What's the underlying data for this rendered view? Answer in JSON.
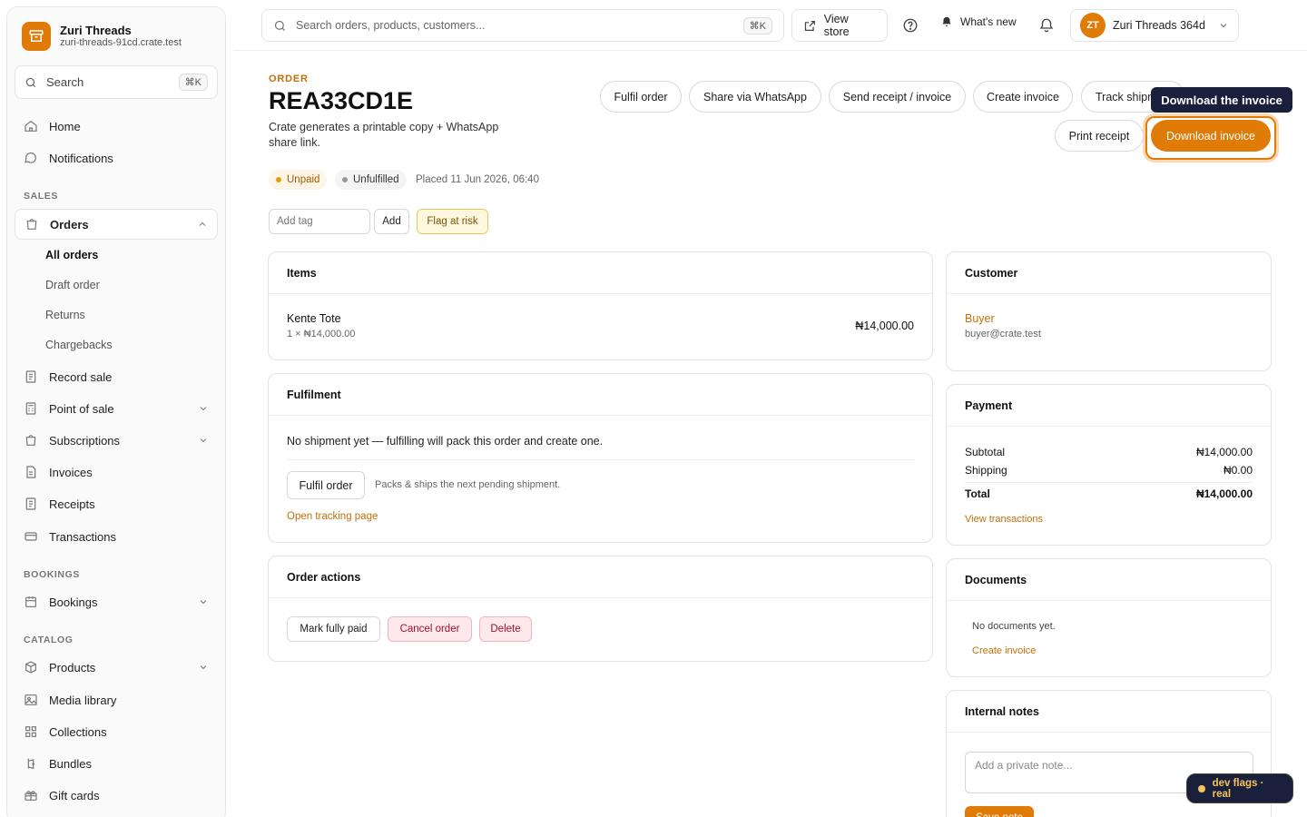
{
  "brand": {
    "name": "Zuri Threads",
    "url": "zuri-threads-91cd.crate.test"
  },
  "sidebar": {
    "search_label": "Search",
    "search_kbd": "⌘K",
    "home": "Home",
    "notifications": "Notifications",
    "sales_heading": "SALES",
    "orders": "Orders",
    "orders_sub": [
      "All orders",
      "Draft order",
      "Returns",
      "Chargebacks"
    ],
    "record_sale": "Record sale",
    "point_of_sale": "Point of sale",
    "subscriptions": "Subscriptions",
    "invoices": "Invoices",
    "receipts": "Receipts",
    "transactions": "Transactions",
    "bookings_heading": "BOOKINGS",
    "bookings": "Bookings",
    "catalog_heading": "CATALOG",
    "products": "Products",
    "media_library": "Media library",
    "collections": "Collections",
    "bundles": "Bundles",
    "gift_cards": "Gift cards"
  },
  "topbar": {
    "search_placeholder": "Search orders, products, customers...",
    "search_kbd": "⌘K",
    "view_store": "View store",
    "whats_new": "What's new",
    "account_initials": "ZT",
    "account_name": "Zuri Threads 364d"
  },
  "order": {
    "eyebrow": "ORDER",
    "id": "REA33CD1E",
    "description": "Crate generates a printable copy + WhatsApp share link.",
    "status_payment": "Unpaid",
    "status_fulfilment": "Unfulfilled",
    "placed": "Placed 11 Jun 2026, 06:40"
  },
  "actions": {
    "fulfil": "Fulfil order",
    "whatsapp": "Share via WhatsApp",
    "send_receipt": "Send receipt / invoice",
    "create_invoice": "Create invoice",
    "track": "Track shipment",
    "print_receipt": "Print receipt",
    "download_invoice": "Download invoice",
    "tooltip": "Download the invoice"
  },
  "tags": {
    "placeholder": "Add tag",
    "add": "Add",
    "flag": "Flag at risk"
  },
  "items_card": {
    "title": "Items",
    "item_name": "Kente Tote",
    "item_qty": "1 × ₦14,000.00",
    "item_total": "₦14,000.00"
  },
  "fulfilment_card": {
    "title": "Fulfilment",
    "message": "No shipment yet — fulfilling will pack this order and create one.",
    "button": "Fulfil order",
    "hint": "Packs & ships the next pending shipment.",
    "tracking_link": "Open tracking page"
  },
  "order_actions_card": {
    "title": "Order actions",
    "mark_paid": "Mark fully paid",
    "cancel": "Cancel order",
    "delete": "Delete"
  },
  "customer_card": {
    "title": "Customer",
    "name": "Buyer",
    "email": "buyer@crate.test"
  },
  "payment_card": {
    "title": "Payment",
    "subtotal_label": "Subtotal",
    "subtotal": "₦14,000.00",
    "shipping_label": "Shipping",
    "shipping": "₦0.00",
    "total_label": "Total",
    "total": "₦14,000.00",
    "transactions_link": "View transactions"
  },
  "documents_card": {
    "title": "Documents",
    "empty": "No documents yet.",
    "create_link": "Create invoice"
  },
  "notes_card": {
    "title": "Internal notes",
    "placeholder": "Add a private note...",
    "save": "Save note"
  },
  "dev_flags": "dev flags · real",
  "colors": {
    "accent": "#e07b07",
    "accent_text": "#c2700a",
    "dark": "#1a1f3c"
  }
}
